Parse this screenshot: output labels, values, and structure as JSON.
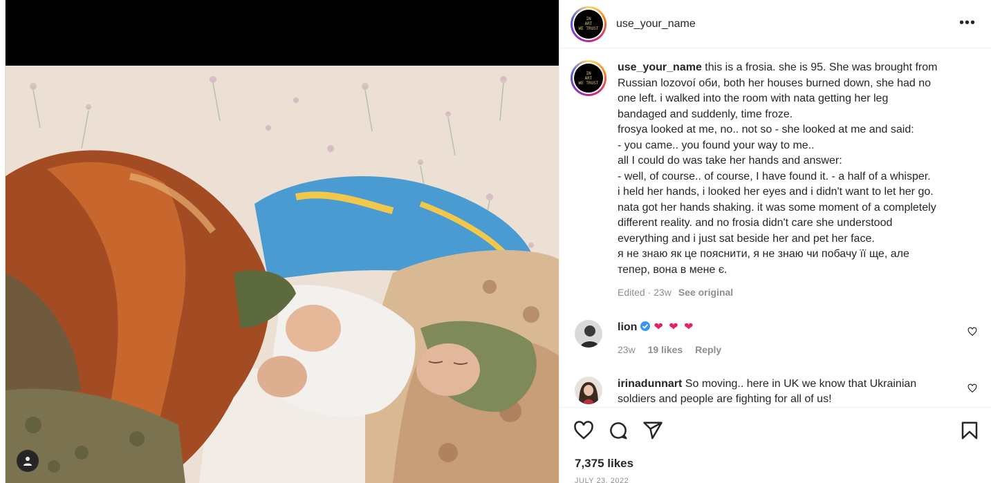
{
  "post": {
    "username": "use_your_name",
    "avatar_text": [
      "IN",
      "ART",
      "WE TRUST"
    ],
    "more_label": "•••"
  },
  "caption": {
    "username": "use_your_name",
    "lines": [
      "this is a frosia. she is 95. She was brought from",
      "Russian lozovoí оби, both her houses burned down, she had no",
      "one left. i walked into the room with nata getting her leg",
      "bandaged and suddenly, time froze.",
      "frosya looked at me, no.. not so - she looked at me and said:",
      "- you came.. you found your way to me..",
      "all I could do was take her hands and answer:",
      "- well, of course.. of course, I have found it. - a half of a whisper.",
      "i held her hands, i looked her eyes and i didn't want to let her go.",
      "nata got her hands shaking. it was some moment of a completely",
      "different reality. and no frosia didn't care she understood",
      "everything and i just sat beside her and pet her face.",
      "я не знаю як це пояснити, я не знаю чи побачу її ще, але",
      "тепер, вона в мене є."
    ],
    "edited": "Edited · 23w",
    "see_original": "See original"
  },
  "comments": [
    {
      "username": "lion",
      "text": "❤ ❤ ❤",
      "time": "23w",
      "likes": "19 likes",
      "reply": "Reply"
    },
    {
      "username": "irinadunnart",
      "text_line1": "So moving.. here in UK we know that Ukrainian",
      "text_line2": "soldiers and people are fighting for all of us!"
    }
  ],
  "likes": "7,375 likes",
  "date": "JULY 23, 2022",
  "colors": {
    "text": "#262626",
    "muted": "#8e8e8e",
    "heart": "#e0245e",
    "verified": "#3897f0"
  }
}
